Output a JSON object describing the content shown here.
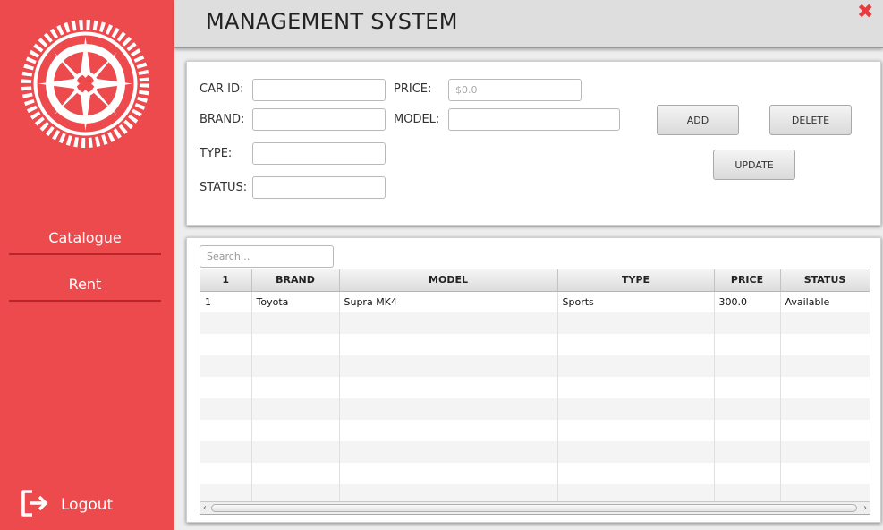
{
  "app": {
    "title": "MANAGEMENT SYSTEM",
    "close_icon": "close-icon"
  },
  "sidebar": {
    "logo_icon": "wheel-logo-icon",
    "items": [
      {
        "label": "Catalogue"
      },
      {
        "label": "Rent"
      }
    ],
    "logout_label": "Logout",
    "logout_icon": "logout-icon"
  },
  "form": {
    "car_id": {
      "label": "CAR ID:",
      "value": ""
    },
    "brand": {
      "label": "BRAND:",
      "value": ""
    },
    "type": {
      "label": "TYPE:",
      "value": ""
    },
    "status": {
      "label": "STATUS:",
      "value": ""
    },
    "price": {
      "label": "PRICE:",
      "value": "",
      "placeholder": "$0.0"
    },
    "model": {
      "label": "MODEL:",
      "value": ""
    },
    "add_label": "ADD",
    "delete_label": "DELETE",
    "update_label": "UPDATE"
  },
  "table": {
    "search_placeholder": "Search...",
    "columns": [
      "1",
      "BRAND",
      "MODEL",
      "TYPE",
      "PRICE",
      "STATUS"
    ],
    "rows": [
      [
        "1",
        "Toyota",
        "Supra MK4",
        "Sports",
        "300.0",
        "Available"
      ]
    ]
  },
  "colors": {
    "sidebar": "#ec4a4d",
    "accent": "#e8393d",
    "header": "#dedede"
  }
}
